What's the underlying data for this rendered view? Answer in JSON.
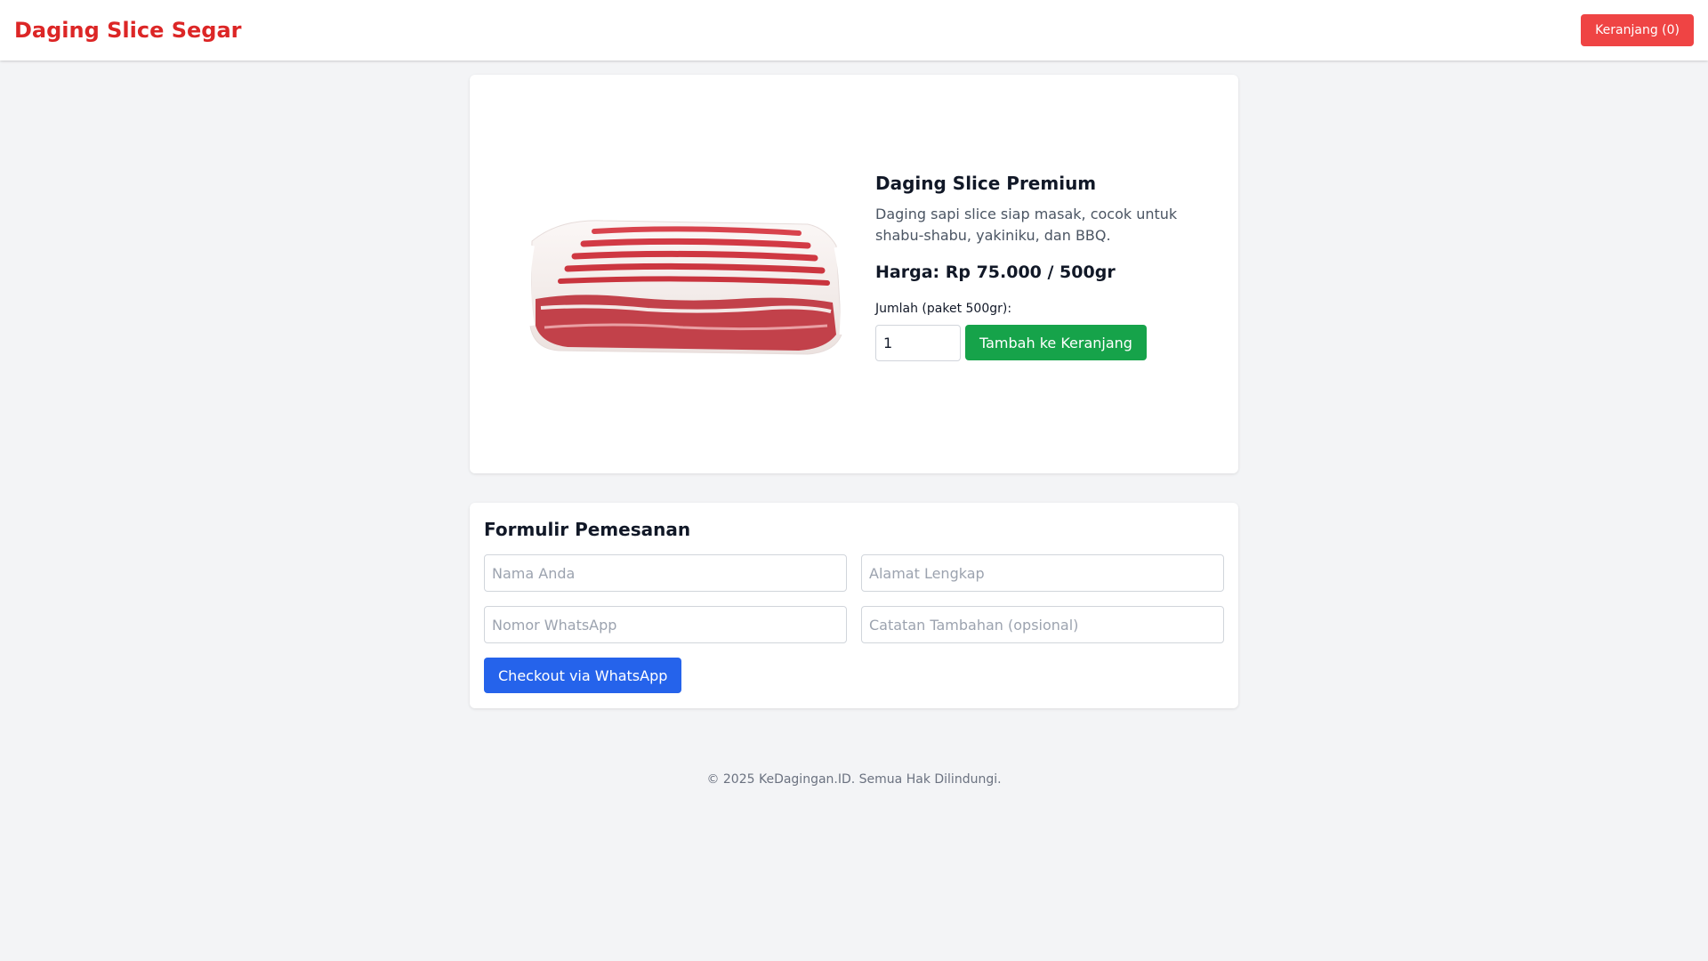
{
  "header": {
    "brand": "Daging Slice Segar",
    "cart_button": "Keranjang (0)"
  },
  "product": {
    "image_alt": "meat-slice-image",
    "name": "Daging Slice Premium",
    "description": "Daging sapi slice siap masak, cocok untuk shabu-shabu, yakiniku, dan BBQ.",
    "price": "Harga: Rp 75.000 / 500gr",
    "quantity_label": "Jumlah (paket 500gr):",
    "quantity_value": "1",
    "add_button": "Tambah ke Keranjang"
  },
  "order_form": {
    "title": "Formulir Pemesanan",
    "name_placeholder": "Nama Anda",
    "address_placeholder": "Alamat Lengkap",
    "whatsapp_placeholder": "Nomor WhatsApp",
    "notes_placeholder": "Catatan Tambahan (opsional)",
    "checkout_button": "Checkout via WhatsApp"
  },
  "footer": {
    "text": "© 2025 KeDagingan.ID. Semua Hak Dilindungi."
  },
  "colors": {
    "brand": "#dc2626",
    "cart_button": "#ef4444",
    "add_button": "#16a34a",
    "checkout_button": "#2563eb",
    "background": "#f3f4f6"
  }
}
